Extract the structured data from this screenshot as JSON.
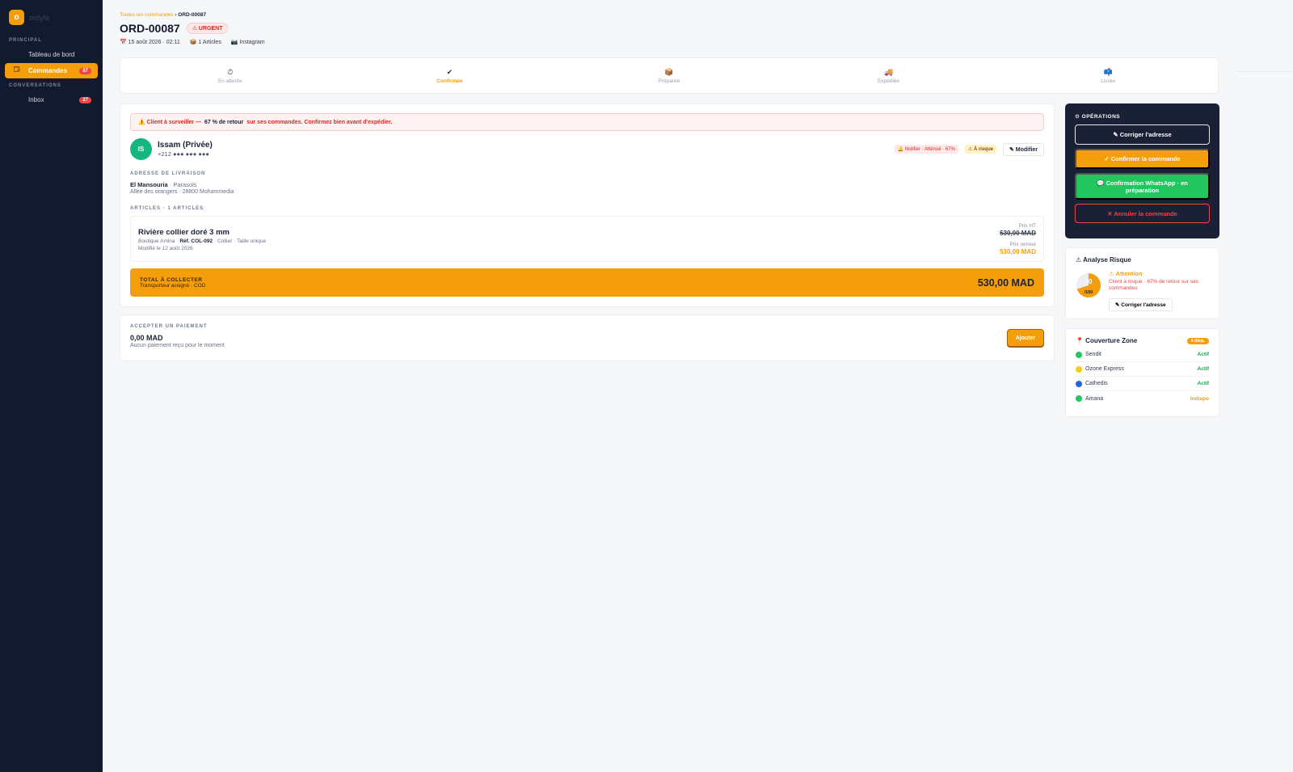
{
  "sidebar": {
    "brand_letter": "o",
    "brand_name": "ordyfa",
    "sections": [
      {
        "title": "PRINCIPAL"
      },
      {
        "title": "CONVERSATIONS"
      }
    ],
    "items": [
      {
        "label": "Tableau de bord",
        "icon": "dashboard-icon"
      },
      {
        "label": "Commandes",
        "badge": "87",
        "icon": "orders-icon",
        "glyph": "🗔"
      },
      {
        "label": "Inbox",
        "badge": "27",
        "icon": "inbox-icon"
      }
    ]
  },
  "header": {
    "breadcrumb_link": "Toutes les commandes",
    "breadcrumb_sep": " › ",
    "breadcrumb_current": "ORD-00087",
    "order_id": "ORD-00087",
    "urgent_label": "⚠ URGENT",
    "meta": [
      {
        "icon": "calendar-icon",
        "text": "📅 15 août 2026 · 02:11"
      },
      {
        "icon": "box-icon",
        "text": "📦 1 Articles"
      },
      {
        "icon": "camera-icon",
        "text": "📷 Instagram"
      }
    ]
  },
  "steps": [
    {
      "icon": "clock-icon",
      "glyph": "⏱",
      "label": "En attente",
      "active": false
    },
    {
      "icon": "check-icon",
      "glyph": "✔",
      "label": "Confirmée",
      "active": true
    },
    {
      "icon": "package-icon",
      "glyph": "📦",
      "label": "Préparée",
      "active": false
    },
    {
      "icon": "truck-icon",
      "glyph": "🚚",
      "label": "Expédiée",
      "active": false
    },
    {
      "icon": "mailbox-icon",
      "glyph": "📫",
      "label": "Livrée",
      "active": false
    }
  ],
  "alert": {
    "prefix": "⚠️ Client à surveiller —",
    "strong": "67 % de retour",
    "suffix": "sur ses commandes. Confirmez bien avant d'expédier."
  },
  "client": {
    "initials": "IS",
    "name": "Issam (Privée)",
    "phone": "+212 ●●● ●●● ●●●",
    "tag_notify": "🔔 Notifier · Atténué · 67%",
    "tag_risk": "⚠ À risque",
    "edit_label": "✎ Modifier"
  },
  "address": {
    "label": "ADRESSE DE LIVRAISON",
    "city": "El Mansouria",
    "place": "· Parasols",
    "line": "Allée des orangers · 28800 Mohammedia"
  },
  "articles": {
    "label": "ARTICLES · 1 ARTICLES",
    "items": [
      {
        "name": "Rivière collier doré 3 mm",
        "shop": "Boutique Amina ·",
        "ref": "Réf. COL-092",
        "details": "· Collier · Taille unique",
        "modified": "Modifié le 12 août 2026",
        "price_label": "Prix HT",
        "price_old": "530,00 MAD",
        "discount_label": "Prix remisé",
        "price_new": "530,00 MAD"
      }
    ]
  },
  "total": {
    "label": "TOTAL À COLLECTER",
    "sub": "Transporteur assigné · COD",
    "amount": "530,00 MAD"
  },
  "payment": {
    "label": "ACCEPTER UN PAIEMENT",
    "amount": "0,00 MAD",
    "note": "Aucun paiement reçu pour le moment",
    "add_label": "Ajouter"
  },
  "operations": {
    "title": "⚙ OPÉRATIONS",
    "fix_address": "✎ Corriger l'adresse",
    "confirm": "✓ Confirmer la commande",
    "whatsapp": "💬 Confirmation WhatsApp · en préparation",
    "cancel": "✕ Annuler la commande"
  },
  "risk": {
    "title": "⚠ Analyse Risque",
    "score": "70",
    "score_fraction": 0.7,
    "max": "/100",
    "attention": "⚠ Attention",
    "desc": "Client à risque · 67% de retour sur ses commandes",
    "fix_label": "✎ Corriger l'adresse"
  },
  "zone": {
    "title": "📍 Couverture Zone",
    "badge": "4 disp.",
    "carriers": [
      {
        "name": "Sendit",
        "status": "Actif",
        "dot": "#22c55e",
        "status_color": "#16a34a"
      },
      {
        "name": "Ozone Express",
        "status": "Actif",
        "dot": "#facc15",
        "status_color": "#16a34a"
      },
      {
        "name": "Cathedis",
        "status": "Actif",
        "dot": "#2563eb",
        "status_color": "#16a34a"
      },
      {
        "name": "Amana",
        "status": "Indispo",
        "dot": "#22c55e",
        "status_color": "#f59e0b"
      }
    ]
  },
  "colors": {
    "accent": "#f59e0b",
    "sidebar_bg": "#131a2e",
    "danger": "#ef4444",
    "success": "#22c55e"
  }
}
